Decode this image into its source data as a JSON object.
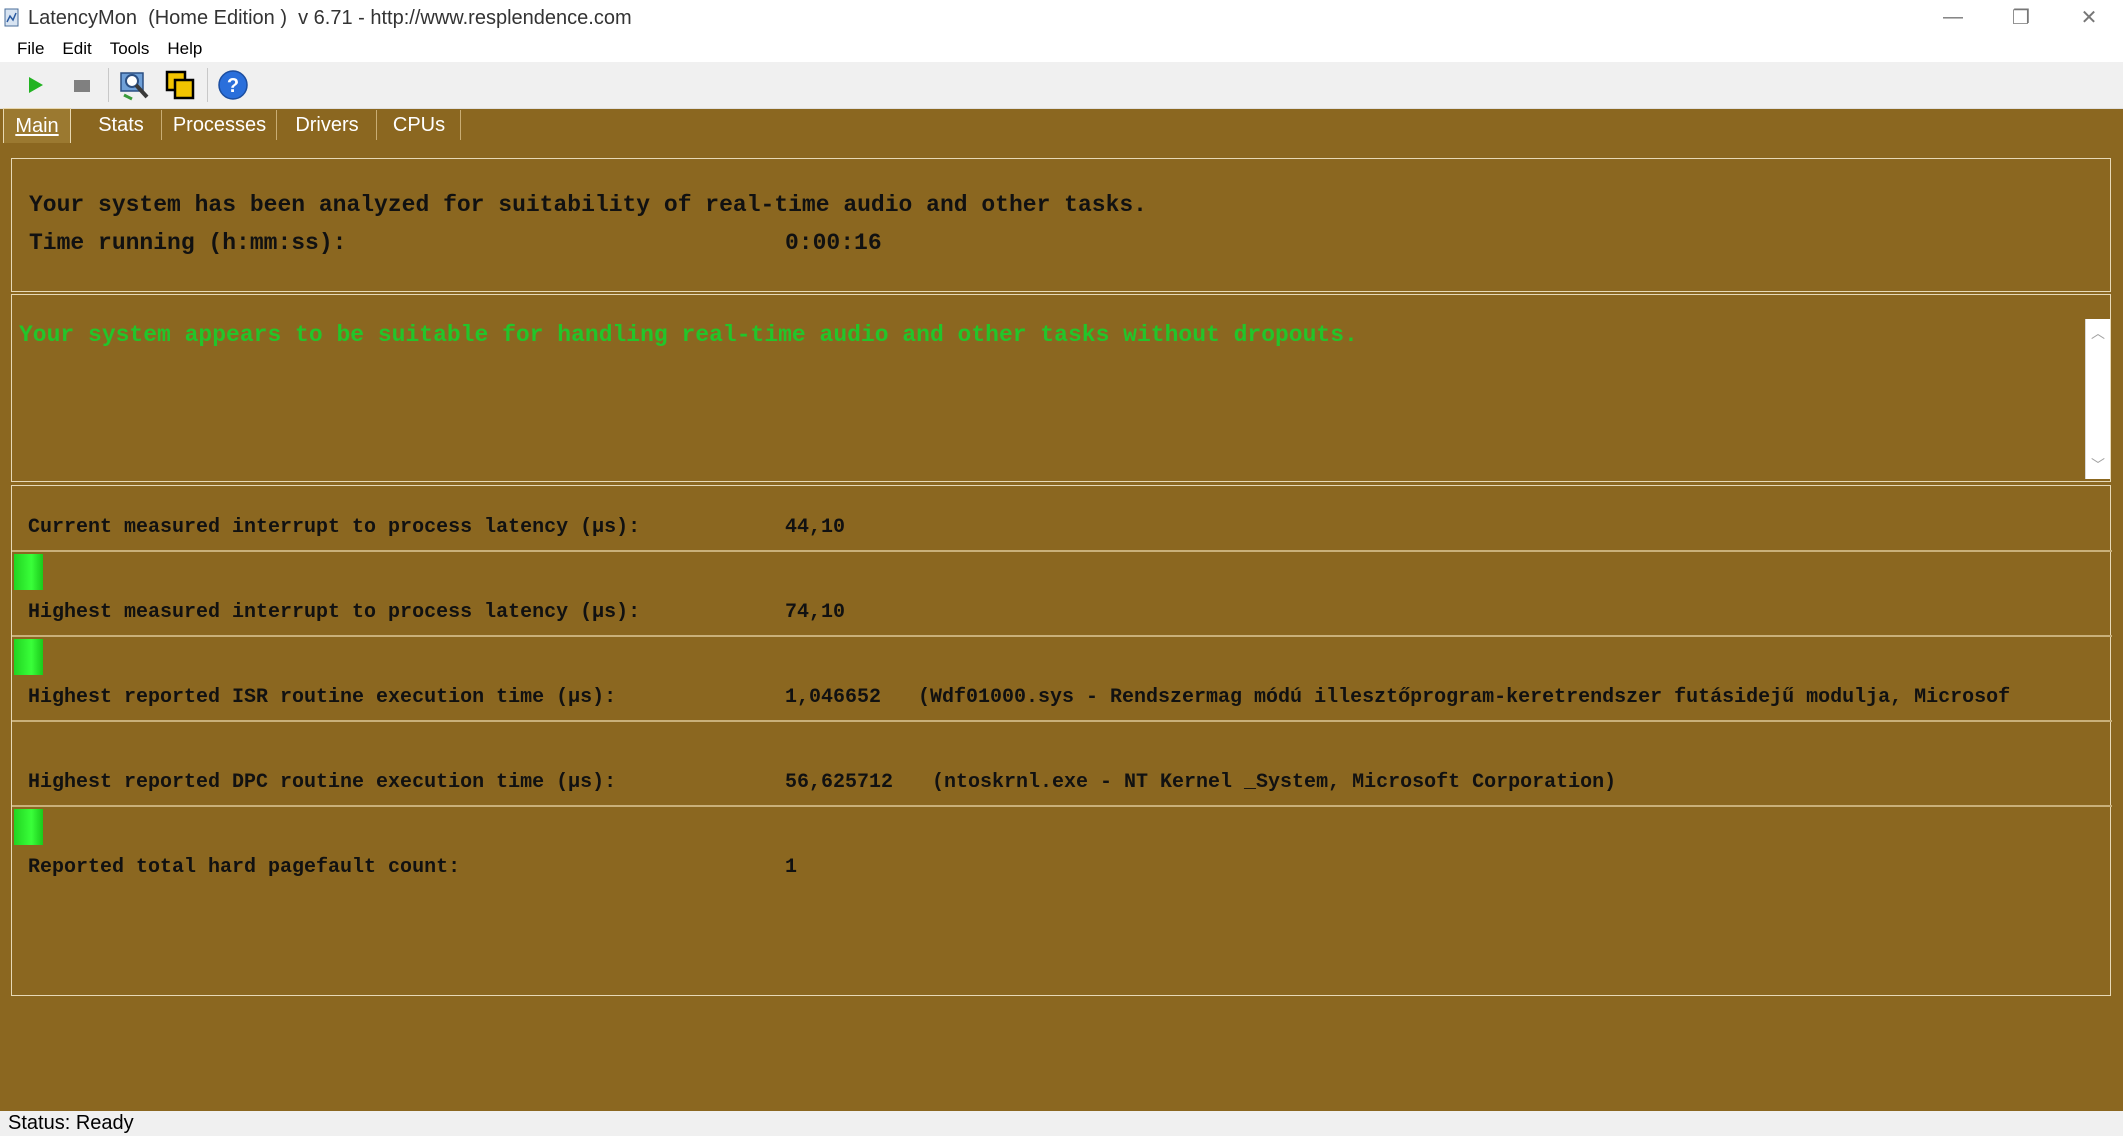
{
  "window": {
    "title": "LatencyMon  (Home Edition )  v 6.71 - http://www.resplendence.com",
    "minimize_glyph": "—",
    "restore_glyph": "❐",
    "close_glyph": "✕"
  },
  "menu": {
    "items": [
      {
        "label": "File"
      },
      {
        "label": "Edit"
      },
      {
        "label": "Tools"
      },
      {
        "label": "Help"
      }
    ]
  },
  "toolbar": {
    "buttons": [
      {
        "icon": "play-icon",
        "color": "#22b322"
      },
      {
        "icon": "stop-icon",
        "color": "#808080"
      },
      {
        "icon": "analyze-icon"
      },
      {
        "icon": "windows-icon"
      },
      {
        "icon": "help-icon",
        "color": "#2a6fdb"
      }
    ]
  },
  "tabs": [
    {
      "label": "Main",
      "active": true
    },
    {
      "label": "Stats"
    },
    {
      "label": "Processes"
    },
    {
      "label": "Drivers"
    },
    {
      "label": "CPUs"
    }
  ],
  "summary": {
    "heading": "Your system has been analyzed for suitability of real-time audio and other tasks.",
    "time_label": "Time running (h:mm:ss):",
    "time_value": "0:00:16"
  },
  "conclusion": {
    "message": "Your system appears to be suitable for handling real-time audio and other tasks without dropouts.",
    "color": "#22c52a"
  },
  "measurements": [
    {
      "label": "Current measured interrupt to process latency (µs):",
      "value": "44,10",
      "detail": "",
      "level": 0.014
    },
    {
      "label": "Highest measured interrupt to process latency (µs):",
      "value": "74,10",
      "detail": "",
      "level": 0.014
    },
    {
      "label": "Highest reported ISR routine execution time (µs):",
      "value": "1,046652",
      "detail": "(Wdf01000.sys - Rendszermag módú illesztőprogram-keretrendszer futásidejű modulja, Microsof",
      "level": 0.0
    },
    {
      "label": "Highest reported DPC routine execution time (µs):",
      "value": "56,625712",
      "detail": "(ntoskrnl.exe - NT Kernel _System, Microsoft Corporation)",
      "level": 0.014
    },
    {
      "label": "Reported total hard pagefault count:",
      "value": "1",
      "detail": ""
    }
  ],
  "status": {
    "text": "Status: Ready"
  }
}
